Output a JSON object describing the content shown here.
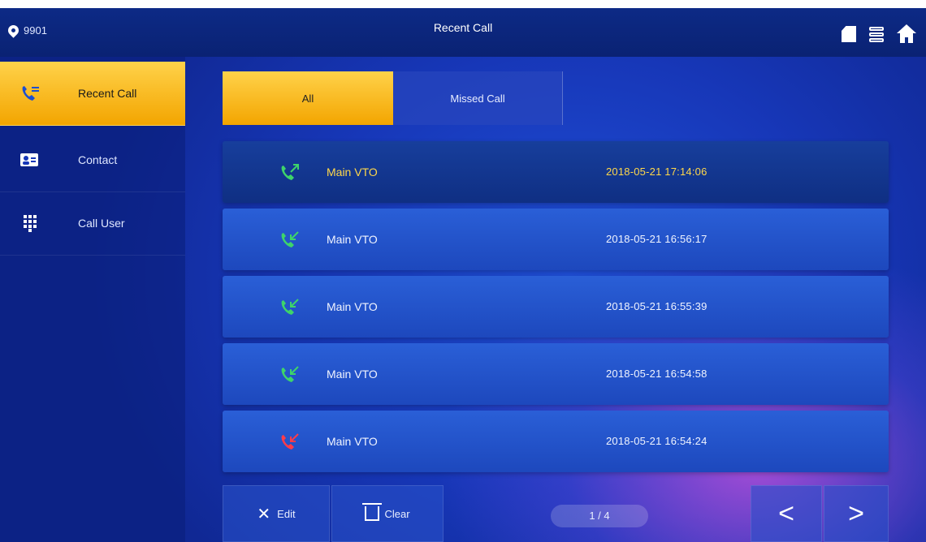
{
  "header": {
    "room_number": "9901",
    "title": "Recent Call"
  },
  "sidebar": {
    "items": [
      {
        "label": "Recent Call",
        "active": true
      },
      {
        "label": "Contact",
        "active": false
      },
      {
        "label": "Call User",
        "active": false
      }
    ]
  },
  "tabs": [
    {
      "label": "All",
      "active": true
    },
    {
      "label": "Missed Call",
      "active": false
    }
  ],
  "calls": [
    {
      "name": "Main VTO",
      "time": "2018-05-21 17:14:06",
      "type": "outgoing",
      "icon": "outgoing-call-icon",
      "color": "#3ed46a",
      "selected": true
    },
    {
      "name": "Main VTO",
      "time": "2018-05-21 16:56:17",
      "type": "incoming",
      "icon": "incoming-call-icon",
      "color": "#3ed46a",
      "selected": false
    },
    {
      "name": "Main VTO",
      "time": "2018-05-21 16:55:39",
      "type": "incoming",
      "icon": "incoming-call-icon",
      "color": "#3ed46a",
      "selected": false
    },
    {
      "name": "Main VTO",
      "time": "2018-05-21 16:54:58",
      "type": "incoming",
      "icon": "incoming-call-icon",
      "color": "#3ed46a",
      "selected": false
    },
    {
      "name": "Main VTO",
      "time": "2018-05-21 16:54:24",
      "type": "missed",
      "icon": "missed-call-icon",
      "color": "#ff3b4a",
      "selected": false
    }
  ],
  "footer": {
    "edit_label": "Edit",
    "clear_label": "Clear",
    "page_indicator": "1 / 4",
    "prev_symbol": "<",
    "next_symbol": ">"
  },
  "colors": {
    "accent": "#f6b418",
    "background": "#1737b8",
    "selected_text": "#ffd84a"
  }
}
